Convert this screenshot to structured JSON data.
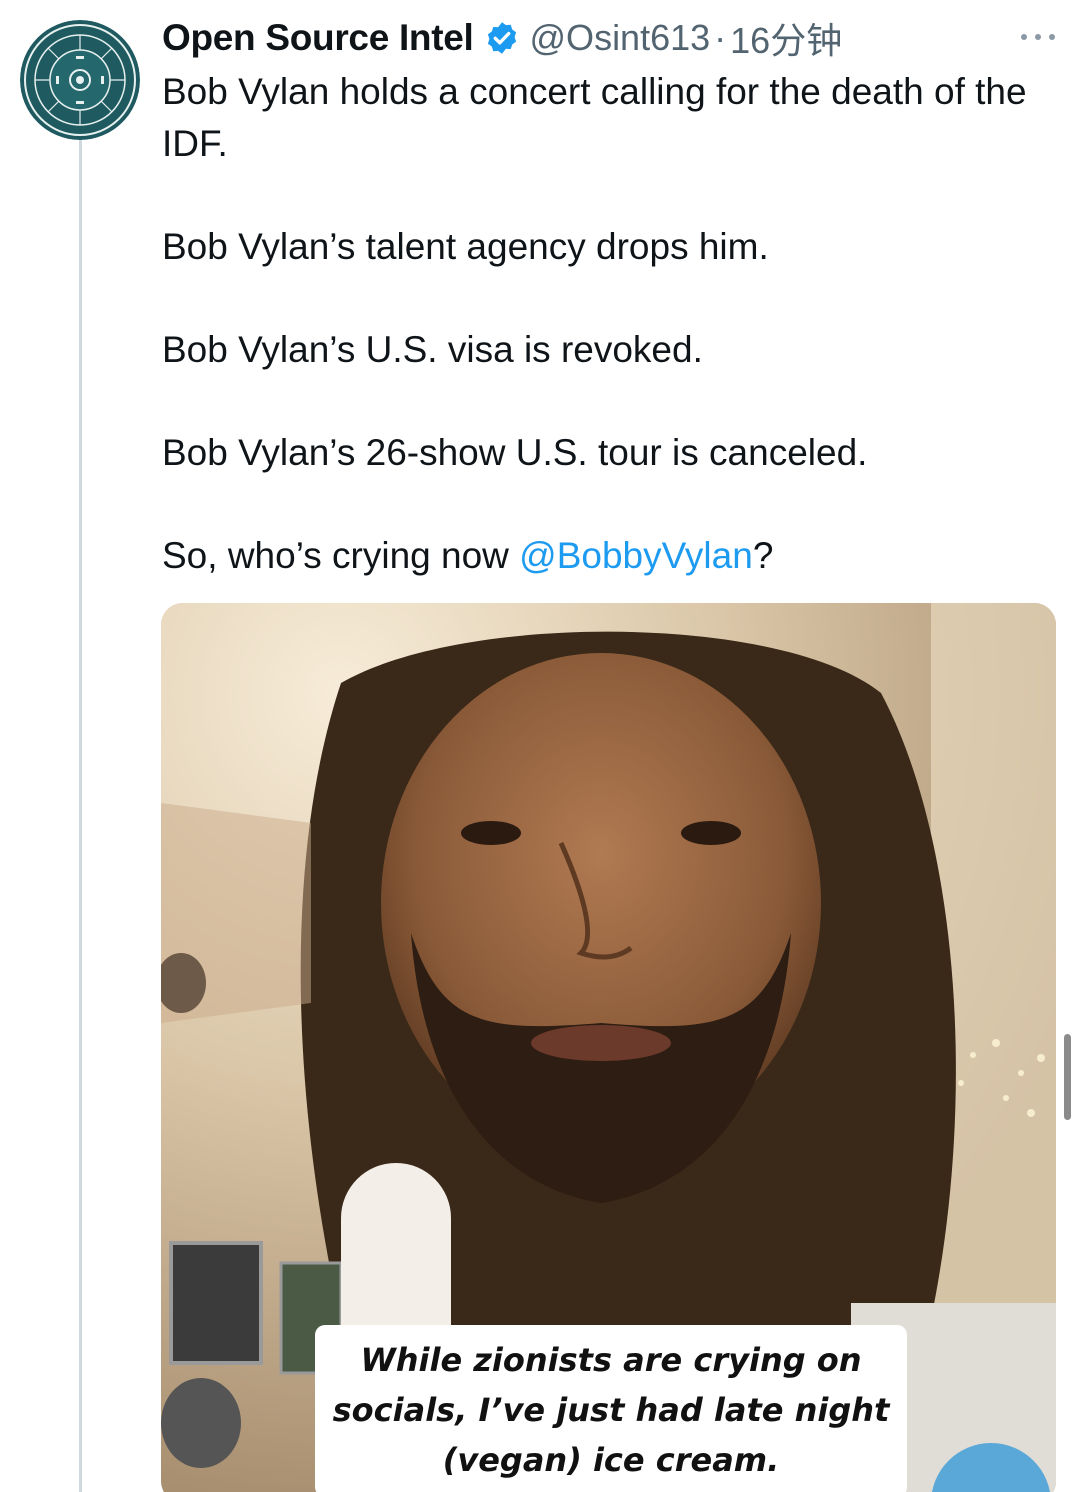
{
  "tweet": {
    "display_name": "Open Source Intel",
    "handle": "@Osint613",
    "separator": "·",
    "time": "16分钟",
    "text_lines": [
      "Bob Vylan holds a concert calling for the death of the IDF.",
      "Bob Vylan’s talent agency drops him.",
      "Bob Vylan’s U.S. visa is revoked.",
      "Bob Vylan’s 26-show U.S. tour is canceled."
    ],
    "last_line_before": "So, who’s crying now ",
    "last_line_mention": "@BobbyVylan",
    "last_line_after": "?",
    "media": {
      "caption": "While zionists are crying on socials, I’ve just had late night (vegan) ice cream."
    }
  },
  "icons": {
    "verified": "verified-badge-icon",
    "more": "more-options-icon"
  },
  "colors": {
    "text": "#0f1419",
    "secondary": "#536471",
    "link": "#1d9bf0",
    "verified": "#1d9bf0",
    "avatar_bg": "#1e5a60"
  }
}
